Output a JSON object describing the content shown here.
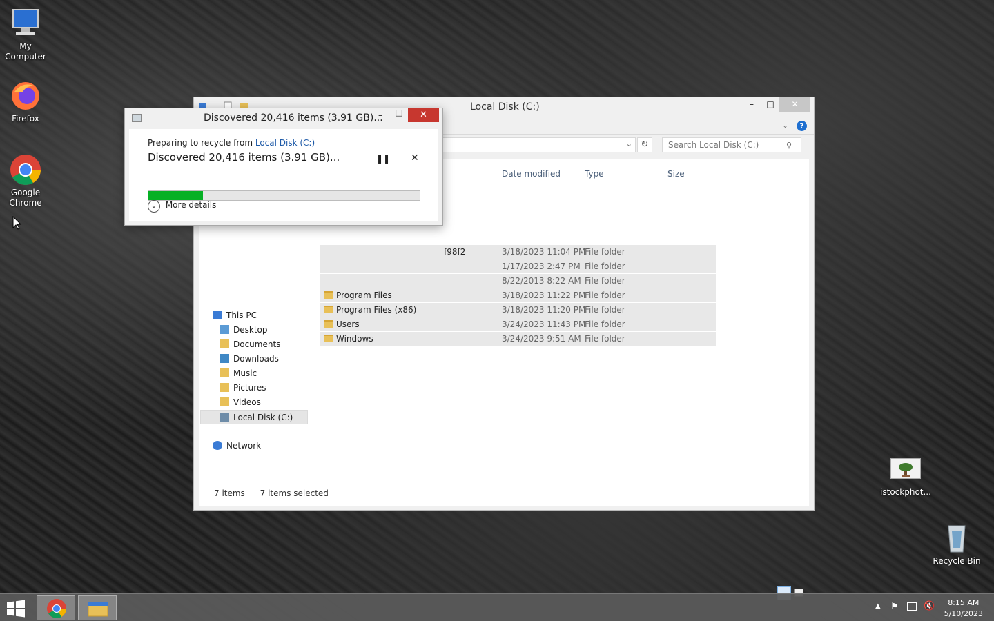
{
  "desktop": {
    "icons": [
      {
        "label_line1": "My",
        "label_line2": "Computer"
      },
      {
        "label_line1": "Firefox",
        "label_line2": ""
      },
      {
        "label_line1": "Google",
        "label_line2": "Chrome"
      },
      {
        "label_line1": "istockphot...",
        "label_line2": ""
      },
      {
        "label_line1": "Recycle Bin",
        "label_line2": ""
      }
    ]
  },
  "explorer": {
    "title": "Local Disk (C:)",
    "search_placeholder": "Search Local Disk (C:)",
    "columns": [
      "Date modified",
      "Type",
      "Size"
    ],
    "nav": [
      "This PC",
      "Desktop",
      "Documents",
      "Downloads",
      "Music",
      "Pictures",
      "Videos",
      "Local Disk (C:)",
      "Network"
    ],
    "rows": [
      {
        "name": "f98f2",
        "date": "3/18/2023 11:04 PM",
        "type": "File folder"
      },
      {
        "name": "",
        "date": "1/17/2023 2:47 PM",
        "type": "File folder"
      },
      {
        "name": "",
        "date": "8/22/2013 8:22 AM",
        "type": "File folder"
      },
      {
        "name": "Program Files",
        "date": "3/18/2023 11:22 PM",
        "type": "File folder"
      },
      {
        "name": "Program Files (x86)",
        "date": "3/18/2023 11:20 PM",
        "type": "File folder"
      },
      {
        "name": "Users",
        "date": "3/24/2023 11:43 PM",
        "type": "File folder"
      },
      {
        "name": "Windows",
        "date": "3/24/2023 9:51 AM",
        "type": "File folder"
      }
    ],
    "status_count": "7 items",
    "status_selected": "7 items selected"
  },
  "dialog": {
    "title": "Discovered 20,416 items (3.91 GB)...",
    "preparing_prefix": "Preparing to recycle from",
    "preparing_link": "Local Disk (C:)",
    "heading": "Discovered 20,416 items (3.91 GB)...",
    "progress_fraction": 0.2,
    "more_details": "More details"
  },
  "taskbar": {
    "time": "8:15 AM",
    "date": "5/10/2023"
  },
  "colors": {
    "progress": "#06b025",
    "link": "#1e5aa8",
    "close_red": "#c7372f"
  }
}
